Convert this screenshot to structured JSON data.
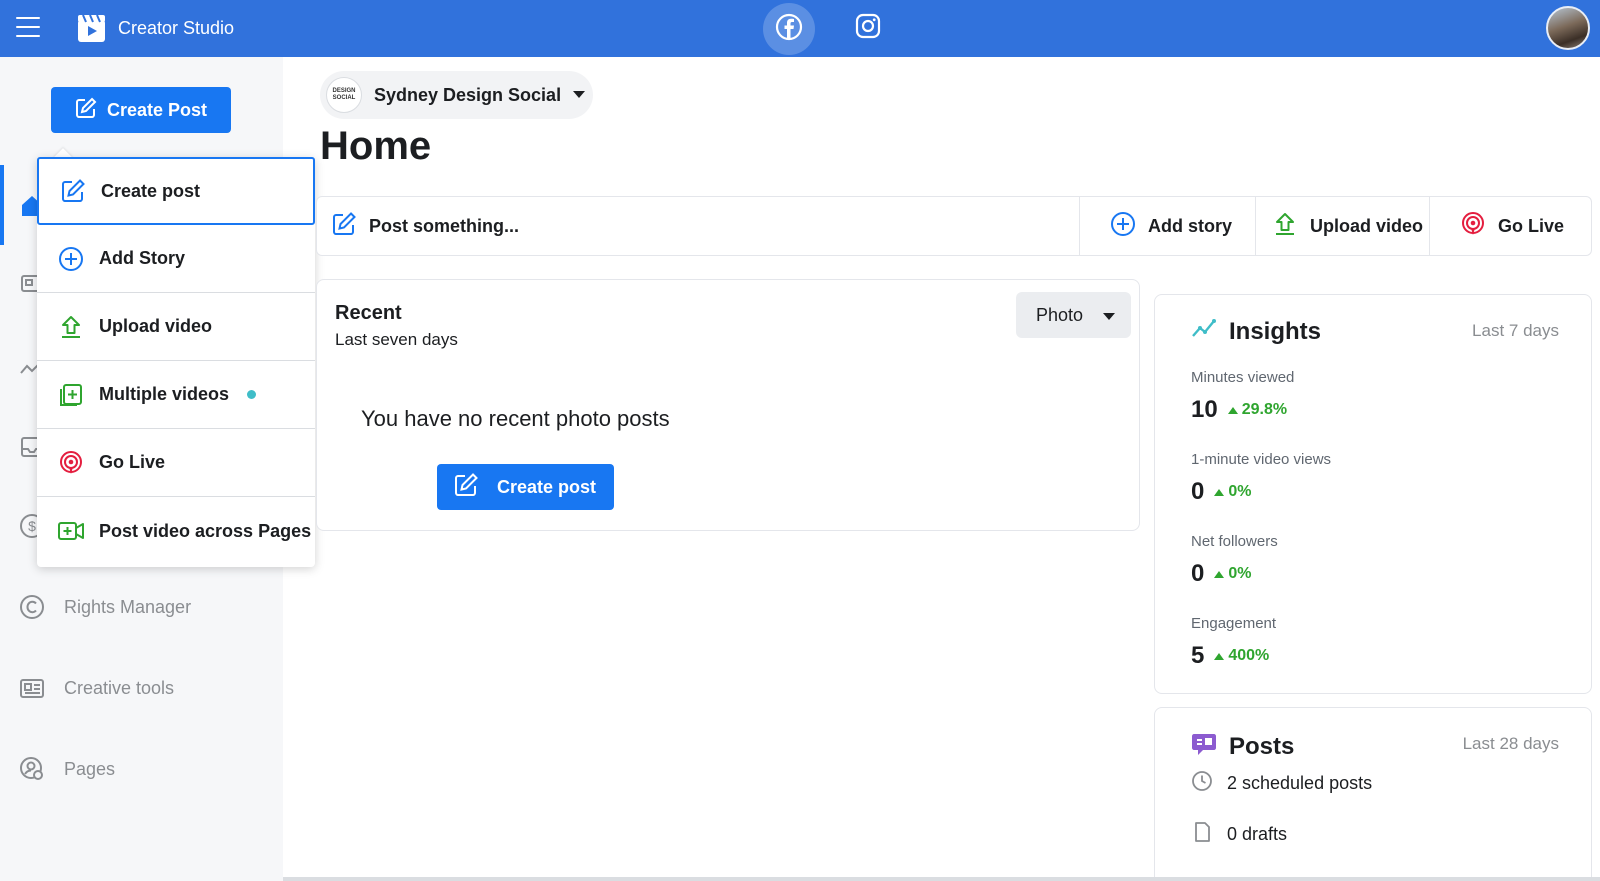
{
  "topbar": {
    "app_title": "Creator Studio",
    "tabs": [
      {
        "icon": "facebook-icon",
        "active": true
      },
      {
        "icon": "instagram-icon",
        "active": false
      }
    ]
  },
  "sidebar": {
    "create_post_label": "Create Post",
    "items": [
      {
        "label": "Rights Manager",
        "icon": "copyright-icon"
      },
      {
        "label": "Creative tools",
        "icon": "creative-tools-icon"
      },
      {
        "label": "Pages",
        "icon": "pages-settings-icon"
      }
    ]
  },
  "dropdown": {
    "items": [
      {
        "label": "Create post",
        "icon": "edit-icon",
        "selected": true
      },
      {
        "label": "Add Story",
        "icon": "plus-circle-icon"
      },
      {
        "label": "Upload video",
        "icon": "upload-icon"
      },
      {
        "label": "Multiple videos",
        "icon": "multiple-videos-icon",
        "badge": "new-dot"
      },
      {
        "label": "Go Live",
        "icon": "live-icon"
      },
      {
        "label": "Post video across Pages",
        "icon": "video-across-pages-icon"
      }
    ]
  },
  "page_switcher": {
    "logo_text": "DESIGN SOCIAL",
    "name": "Sydney Design Social"
  },
  "main": {
    "title": "Home",
    "actions": {
      "post_something": "Post something...",
      "add_story": "Add story",
      "upload_video": "Upload video",
      "go_live": "Go Live"
    },
    "recent": {
      "title": "Recent",
      "subtitle": "Last seven days",
      "filter_value": "Photo",
      "empty_text": "You have no recent photo posts",
      "button_label": "Create post"
    }
  },
  "insights": {
    "title": "Insights",
    "range": "Last 7 days",
    "metrics": [
      {
        "label": "Minutes viewed",
        "value": "10",
        "change": "29.8%"
      },
      {
        "label": "1-minute video views",
        "value": "0",
        "change": "0%"
      },
      {
        "label": "Net followers",
        "value": "0",
        "change": "0%"
      },
      {
        "label": "Engagement",
        "value": "5",
        "change": "400%"
      }
    ]
  },
  "posts": {
    "title": "Posts",
    "range": "Last 28 days",
    "lines": [
      {
        "text": "2 scheduled posts",
        "icon": "clock-icon"
      },
      {
        "text": "0 drafts",
        "icon": "draft-icon"
      }
    ]
  },
  "colors": {
    "topbar": "#3172dc",
    "primary": "#1877f2",
    "positive": "#2fa52f",
    "live": "#e41e3f",
    "upload": "#2fa52f"
  }
}
